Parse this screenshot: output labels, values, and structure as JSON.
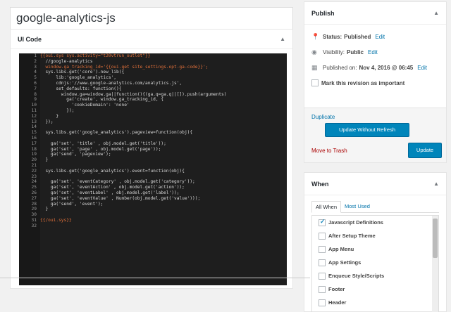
{
  "post": {
    "title": "google-analytics-js"
  },
  "code_box": {
    "label": "UI Code",
    "lines": [
      "{{oui.sys sys.activity=\"t20vtrun_outlet\"}}",
      "  //google-analytics",
      "  window.ga_tracking_id='{{oui.get site_settings.opt-ga-code}}';",
      "  sys.libs.get('core').new_lib({",
      "      lib:'google_analytics',",
      "      cdnjs:'//www.google-analytics.com/analytics.js',",
      "      set_defaults: function(){",
      "        window.ga=window.ga||function(){(ga.q=ga.q||[]).push(arguments)",
      "          ga('create', window.ga_tracking_id, {",
      "            'cookieDomain': 'none'",
      "          });",
      "      }",
      "  });",
      "",
      "  sys.libs.get('google_analytics').pageview=function(obj){",
      "",
      "    ga('set', 'title' , obj.model.get('title'));",
      "    ga('set', 'page' , obj.model.get('page'));",
      "    ga('send', 'pageview');",
      "  }",
      "",
      "  sys.libs.get('google_analytics').event=function(obj){",
      "",
      "    ga('set', 'eventCategory' , obj.model.get('category'));",
      "    ga('set', 'eventAction' , obj.model.get('action'));",
      "    ga('set', 'eventLabel' , obj.model.get('label'));",
      "    ga('set', 'eventValue' , Number(obj.model.get('value')));",
      "    ga('send', 'event');",
      "  }",
      "",
      "{{/oui.sys}}",
      ""
    ]
  },
  "publish": {
    "title": "Publish",
    "status_label": "Status:",
    "status_value": "Published",
    "status_edit": "Edit",
    "visibility_label": "Visibility:",
    "visibility_value": "Public",
    "visibility_edit": "Edit",
    "published_on_label": "Published on:",
    "published_on_value": "Nov 4, 2016 @ 06:45",
    "published_on_edit": "Edit",
    "mark_revision": "Mark this revision as important",
    "duplicate": "Duplicate",
    "update_without_refresh": "Update Without Refresh",
    "move_to_trash": "Move to Trash",
    "update": "Update"
  },
  "when": {
    "title": "When",
    "tabs": [
      "All When",
      "Most Used"
    ],
    "items": [
      {
        "label": "Javascript Definitions",
        "checked": true
      },
      {
        "label": "After Setup Theme",
        "checked": false
      },
      {
        "label": "App Menu",
        "checked": false
      },
      {
        "label": "App Settings",
        "checked": false
      },
      {
        "label": "Enqueue Style/Scripts",
        "checked": false
      },
      {
        "label": "Footer",
        "checked": false
      },
      {
        "label": "Header",
        "checked": false
      }
    ]
  },
  "icons": {
    "status": "pin-icon",
    "visibility": "eye-icon",
    "calendar": "calendar-icon",
    "collapse": "triangle-up-icon"
  },
  "colors": {
    "accent": "#0085ba",
    "link": "#0073aa",
    "trash": "#a00000",
    "editor_bg": "#1e1e1e",
    "template_tag": "#e2703a"
  }
}
